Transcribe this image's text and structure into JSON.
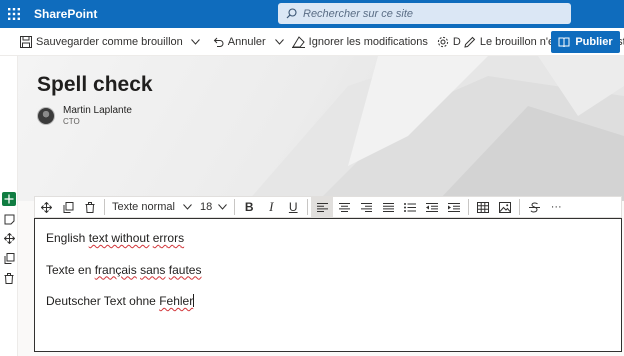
{
  "suite": {
    "app_name": "SharePoint"
  },
  "search": {
    "placeholder": "Rechercher sur ce site"
  },
  "commands": {
    "save_draft": "Sauvegarder comme brouillon",
    "undo": "Annuler",
    "discard": "Ignorer les modifications",
    "details_letter": "D",
    "draft_status": "Le brouillon n'est pas enregistré",
    "publish": "Publier"
  },
  "page": {
    "title": "Spell check",
    "author_name": "Martin Laplante",
    "author_role": "CTO"
  },
  "format_toolbar": {
    "text_style": "Texte normal",
    "font_size": "18",
    "bold": "B",
    "italic": "I",
    "underline": "U",
    "more": "···"
  },
  "editor": {
    "p1": {
      "a": "English ",
      "b": "text without",
      "c": " ",
      "d": "errors"
    },
    "p2": {
      "a": "Texte en ",
      "b": "français",
      "c": " ",
      "d": "sans",
      "e": " ",
      "f": "fautes"
    },
    "p3": {
      "a": "Deutscher Text ohne ",
      "b": "Fehler"
    }
  },
  "colors": {
    "suite_bar": "#0f6cbd",
    "publish_button": "#0f6cbd",
    "add_section_button": "#107c41",
    "spelling_squiggle": "#d13438"
  },
  "icons": {
    "waffle": "waffle-icon",
    "search": "search-icon",
    "save": "save-icon",
    "undo": "undo-icon",
    "discard": "discard-icon",
    "settings": "gear-icon",
    "edit": "pencil-icon",
    "publish": "book-icon"
  }
}
